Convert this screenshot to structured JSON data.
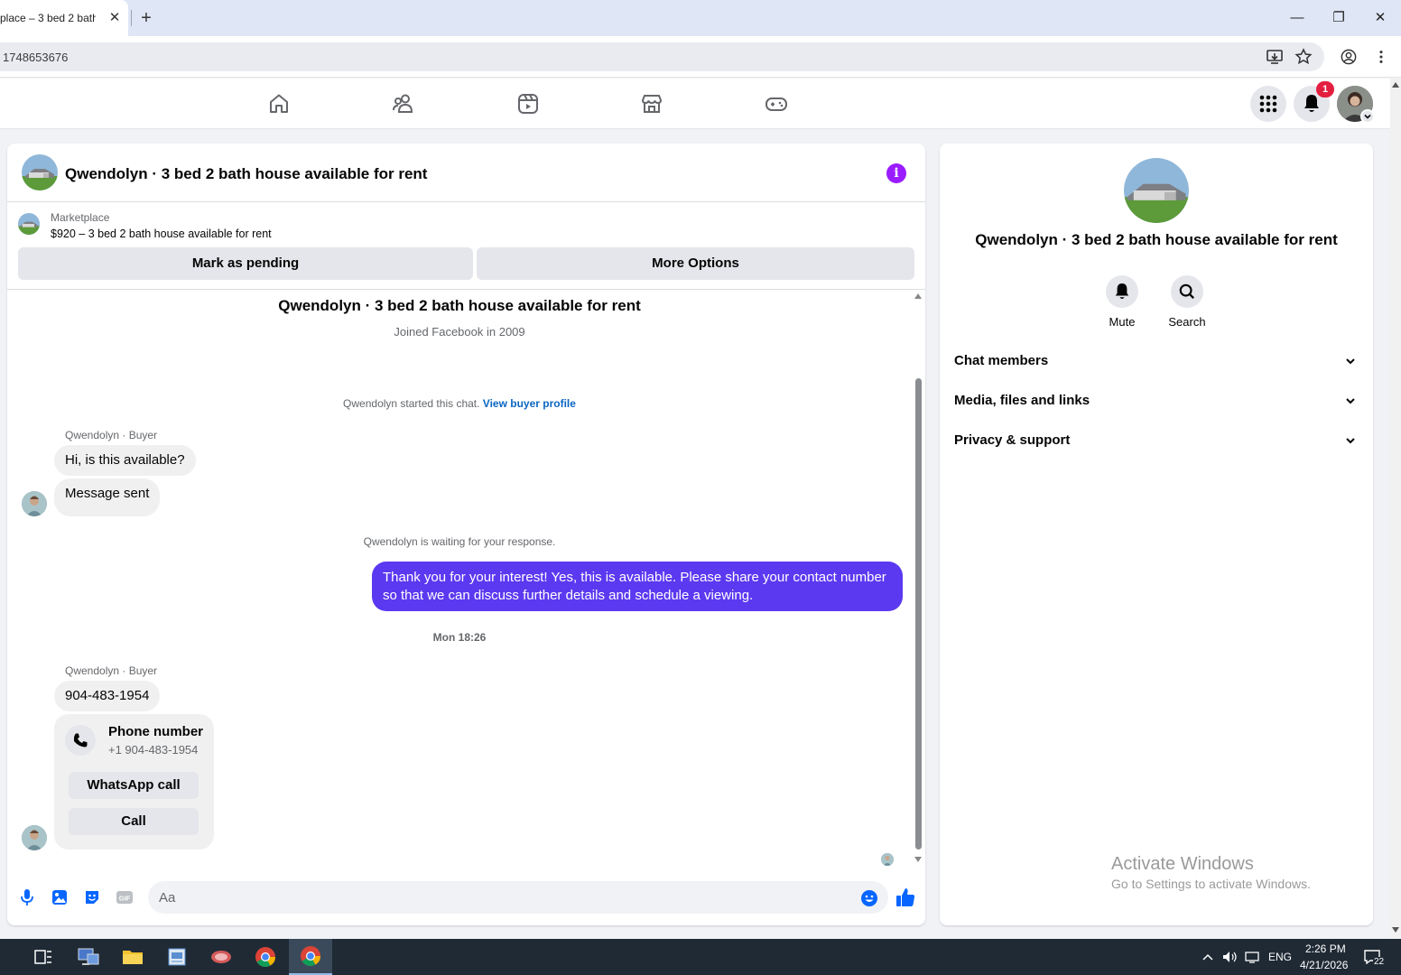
{
  "browser": {
    "tab_title": "place – 3 bed 2 bath",
    "tab_close": "✕",
    "new_tab": "+",
    "url": "1748653676",
    "window_controls": {
      "minimize": "—",
      "maximize": "❐",
      "close": "✕"
    }
  },
  "fb_nav": {
    "items": [
      "home-icon",
      "friends-icon",
      "watch-icon",
      "marketplace-icon",
      "gaming-icon"
    ],
    "notification_count": "1"
  },
  "chat": {
    "header_title": "Qwendolyn · 3 bed 2 bath house available for rent",
    "marketplace_label": "Marketplace",
    "listing": "$920 – 3 bed 2 bath house available for rent",
    "mark_pending": "Mark as pending",
    "more_options": "More Options",
    "thread_title": "Qwendolyn · 3 bed 2 bath house available for rent",
    "joined": "Joined Facebook in 2009",
    "started_text": "Qwendolyn started this chat. ",
    "view_buyer_profile": "View buyer profile",
    "sender_1": "Qwendolyn · Buyer",
    "msg_1": "Hi, is this available?",
    "msg_2": "Message sent",
    "waiting": "Qwendolyn is waiting for your response.",
    "reply": "Thank you for your interest! Yes, this is available. Please share your contact number so that we can discuss further details and schedule a viewing.",
    "timestamp": "Mon 18:26",
    "sender_2": "Qwendolyn · Buyer",
    "msg_3": "904-483-1954",
    "phone_card": {
      "title": "Phone number",
      "number": "+1 904-483-1954",
      "whatsapp": "WhatsApp call",
      "call": "Call"
    },
    "composer_placeholder": "Aa"
  },
  "right_panel": {
    "title": "Qwendolyn · 3 bed 2 bath house available for rent",
    "mute": "Mute",
    "search": "Search",
    "sections": [
      "Chat members",
      "Media, files and links",
      "Privacy & support"
    ]
  },
  "watermark": {
    "line1": "Activate Windows",
    "line2": "Go to Settings to activate Windows."
  },
  "taskbar": {
    "lang": "ENG",
    "time": "2:26 PM",
    "date": "4/21/2026",
    "notifications": "22"
  },
  "colors": {
    "accent": "#5b39f0",
    "info": "#9b1bff",
    "link": "#0a66c2",
    "badge": "#e41e3f",
    "fb_blue": "#0866ff"
  }
}
